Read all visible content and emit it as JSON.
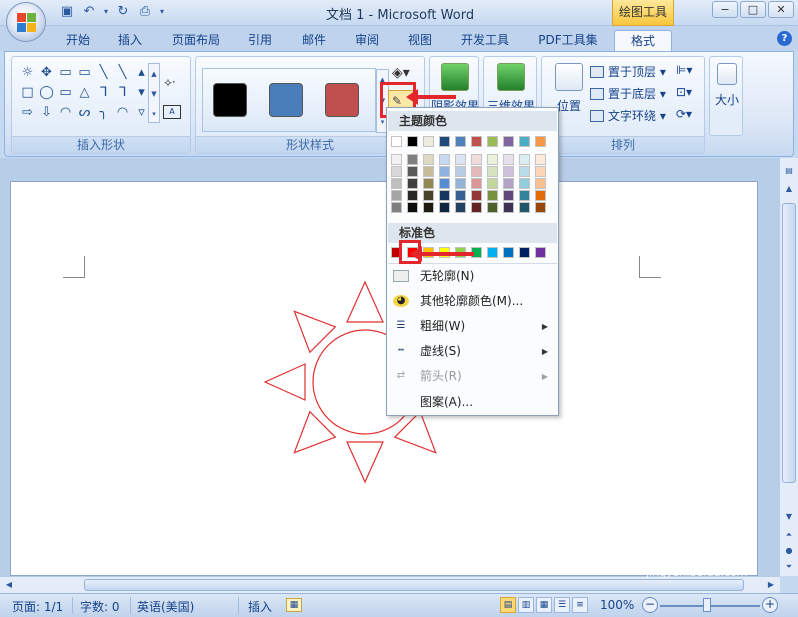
{
  "window": {
    "title": "文档 1 - Microsoft Word",
    "context_tab": "绘图工具",
    "controls": [
      "−",
      "□",
      "✕"
    ]
  },
  "tabs": [
    {
      "label": "开始"
    },
    {
      "label": "插入"
    },
    {
      "label": "页面布局"
    },
    {
      "label": "引用"
    },
    {
      "label": "邮件"
    },
    {
      "label": "审阅"
    },
    {
      "label": "视图"
    },
    {
      "label": "开发工具"
    },
    {
      "label": "PDF工具集"
    },
    {
      "label": "格式"
    }
  ],
  "active_tab": "格式",
  "help_label": "?",
  "ribbon": {
    "groups": {
      "insert_shapes": "插入形状",
      "shape_styles": "形状样式",
      "arrange": "排列"
    },
    "shape_glyphs": [
      "☼",
      "✥",
      "▭",
      "▭",
      "╲",
      "╲",
      "▴",
      "□",
      "◯",
      "▭",
      "△",
      "ᒣ",
      "ᒣ",
      "▾",
      "⇨",
      "⇩",
      "◠",
      "ᔕ",
      "╮",
      "◠",
      "▿"
    ],
    "style_swatches": [
      {
        "name": "black",
        "color": "#000000"
      },
      {
        "name": "blue",
        "color": "#4a7ebb"
      },
      {
        "name": "red",
        "color": "#c0504d"
      }
    ],
    "shadow_effects": "阴影效果",
    "threed_effects": "三维效果",
    "position": "位置",
    "bring_to_front": "置于顶层",
    "send_to_back": "置于底层",
    "text_wrap": "文字环绕",
    "size": "大小",
    "outline_current_color": "#e01c1c"
  },
  "outline_menu": {
    "theme_colors_title": "主题颜色",
    "theme_colors_top": [
      "#ffffff",
      "#000000",
      "#eeece1",
      "#1f497d",
      "#4f81bd",
      "#c0504d",
      "#9bbb59",
      "#8064a2",
      "#4bacc6",
      "#f79646"
    ],
    "theme_colors_shades": [
      [
        "#f2f2f2",
        "#7f7f7f",
        "#ddd9c3",
        "#c6d9f0",
        "#dbe5f1",
        "#f2dcdb",
        "#ebf1dd",
        "#e5e0ec",
        "#dbeef3",
        "#fdeada"
      ],
      [
        "#d8d8d8",
        "#595959",
        "#c4bd97",
        "#8db3e2",
        "#b8cce4",
        "#e5b9b7",
        "#d7e3bc",
        "#ccc1d9",
        "#b7dde8",
        "#fbd5b5"
      ],
      [
        "#bfbfbf",
        "#3f3f3f",
        "#938953",
        "#548dd4",
        "#95b3d7",
        "#d99694",
        "#c3d69b",
        "#b2a2c7",
        "#92cddc",
        "#fac08f"
      ],
      [
        "#a5a5a5",
        "#262626",
        "#494429",
        "#17365d",
        "#366092",
        "#953734",
        "#76923c",
        "#5f497a",
        "#31859b",
        "#e36c09"
      ],
      [
        "#7f7f7f",
        "#0c0c0c",
        "#1d1b10",
        "#0f243e",
        "#244061",
        "#632423",
        "#4f6128",
        "#3f3151",
        "#205867",
        "#974806"
      ]
    ],
    "standard_colors_title": "标准色",
    "standard_colors": [
      "#c00000",
      "#ff0000",
      "#ffc000",
      "#ffff00",
      "#92d050",
      "#00b050",
      "#00b0f0",
      "#0070c0",
      "#002060",
      "#7030a0"
    ],
    "selected_standard_color": "#ff0000",
    "items": [
      {
        "label": "无轮廓(N)",
        "has_submenu": false,
        "disabled": false
      },
      {
        "label": "其他轮廓颜色(M)...",
        "has_submenu": false,
        "disabled": false
      },
      {
        "label": "粗细(W)",
        "has_submenu": true,
        "disabled": false
      },
      {
        "label": "虚线(S)",
        "has_submenu": true,
        "disabled": false
      },
      {
        "label": "箭头(R)",
        "has_submenu": true,
        "disabled": true
      },
      {
        "label": "图案(A)...",
        "has_submenu": false,
        "disabled": false
      }
    ]
  },
  "document": {
    "shape_outline_color": "#e03030"
  },
  "statusbar": {
    "page": "页面: 1/1",
    "words": "字数: 0",
    "language": "英语(美国)",
    "mode": "插入",
    "zoom": "100%"
  },
  "watermark": {
    "brand": "Bai 经验",
    "url": "jingyan.baidu.com"
  }
}
